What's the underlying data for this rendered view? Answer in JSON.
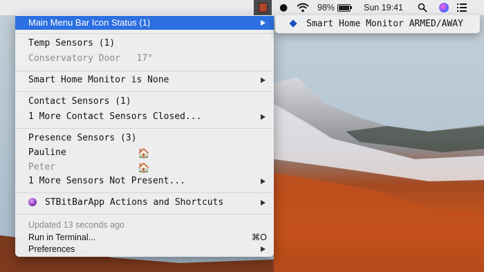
{
  "menubar": {
    "battery_percent": "98%",
    "battery_level": 0.98,
    "clock": "Sun 19:41"
  },
  "menu": {
    "status_row": "Main Menu Bar Icon Status (1)",
    "temp_header": "Temp Sensors (1)",
    "temp_sensor": "Conservatory Door   17°",
    "shm_row": "Smart Home Monitor is None",
    "contact_header": "Contact Sensors (1)",
    "contact_more": "1 More Contact Sensors Closed...",
    "presence_header": "Presence Sensors (3)",
    "presence_people": [
      {
        "name": "Pauline",
        "icon": "house-icon"
      },
      {
        "name": "Peter",
        "icon": "house-icon"
      }
    ],
    "presence_more": "1 More Sensors Not Present...",
    "actions_row": "STBitBarApp Actions and Shortcuts",
    "updated": "Updated 13 seconds ago",
    "run_terminal": "Run in Terminal...",
    "run_terminal_shortcut": "⌘O",
    "preferences": "Preferences"
  },
  "submenu": {
    "item": "Smart Home Monitor ARMED/AWAY"
  },
  "colors": {
    "highlight": "#2c6fe0",
    "diamond": "#1a4fc4"
  }
}
